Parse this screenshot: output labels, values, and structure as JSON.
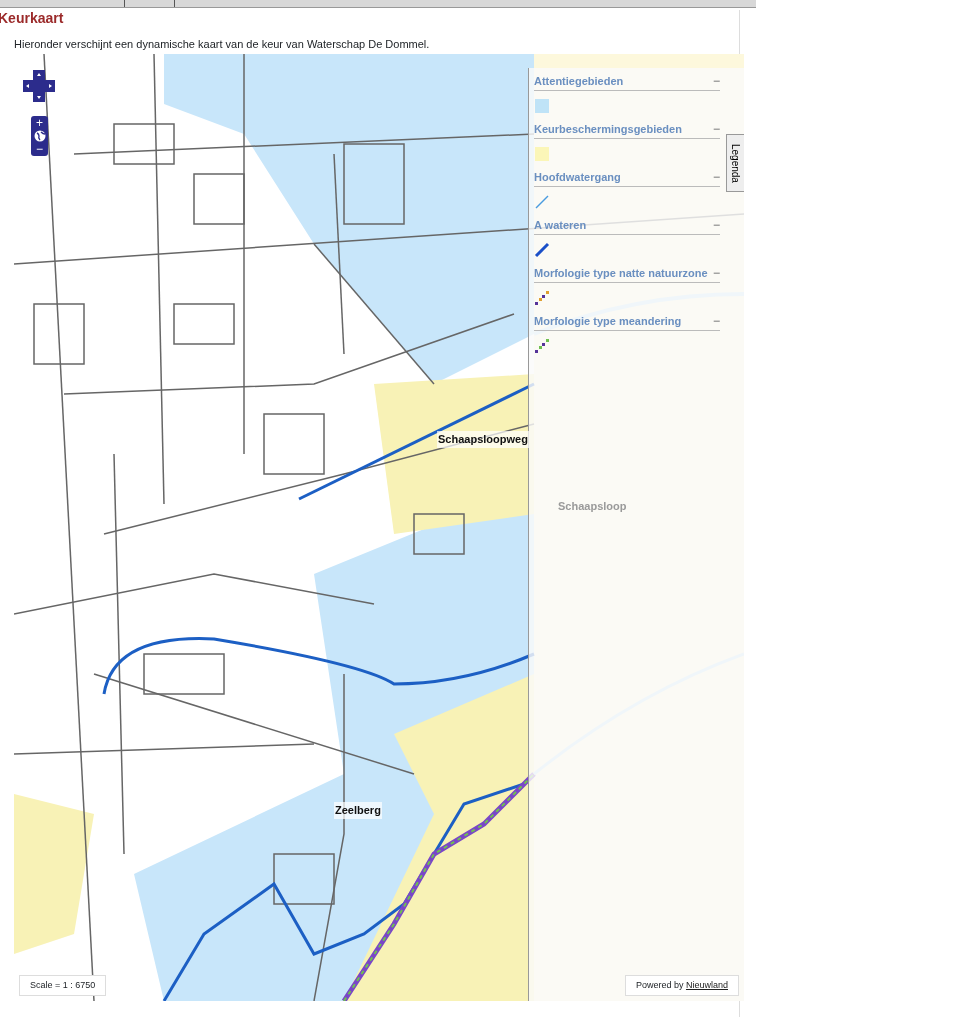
{
  "page": {
    "title": "Keurkaart",
    "intro": "Hieronder verschijnt een dynamische kaart van de keur van Waterschap De Dommel."
  },
  "map": {
    "zoom_in": "+",
    "zoom_out": "−",
    "labels": [
      {
        "text": "Schaapsloopweg",
        "faded": false
      },
      {
        "text": "Schaapsloop",
        "faded": true
      },
      {
        "text": "Zeelberg",
        "faded": false
      }
    ],
    "scale": "Scale = 1 : 6750",
    "credit": {
      "prefix": "Powered by",
      "link": "Nieuwland"
    }
  },
  "legend": {
    "tab": "Legenda",
    "items": [
      {
        "title": "Attentiegebieden",
        "toggle": "−",
        "kind": "area",
        "color": "#bfe3f7"
      },
      {
        "title": "Keurbeschermingsgebieden",
        "toggle": "−",
        "kind": "area",
        "color": "#fbf6b8"
      },
      {
        "title": "Hoofdwatergang",
        "toggle": "−",
        "kind": "line",
        "color": "#4a9be0"
      },
      {
        "title": "A wateren",
        "toggle": "−",
        "kind": "thickline",
        "color": "#1a4fc8"
      },
      {
        "title": "Morfologie type natte natuurzone",
        "toggle": "−",
        "kind": "dotted",
        "color": "#e0a030"
      },
      {
        "title": "Morfologie type meandering",
        "toggle": "−",
        "kind": "dotted",
        "color": "#6fc050"
      }
    ]
  }
}
